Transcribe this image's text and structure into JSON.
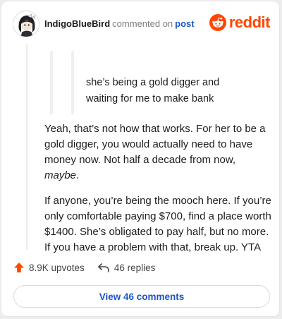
{
  "header": {
    "username": "IndigoBlueBird",
    "action": "commented on",
    "post_link": "post",
    "brand_name": "reddit",
    "brand_color": "#ff4500",
    "avatar_icon": "user-avatar-illustration",
    "brand_icon": "reddit-snoo-icon"
  },
  "quote": {
    "line1": "she’s being a gold digger and",
    "line2": "waiting for me to make bank"
  },
  "comment": {
    "p1_main": "Yeah, that’s not how that works. For her to be a gold digger, you would actually need to have money now. Not half a decade from now, ",
    "p1_em": "maybe",
    "p1_end": ".",
    "p2": "If anyone, you’re being the mooch here. If you’re only comfortable paying $700, find a place worth $1400. She’s obligated to pay half, but no more. If you have a problem with that, break up. YTA"
  },
  "footer": {
    "upvotes": "8.9K upvotes",
    "replies": "46 replies",
    "view_comments": "View 46 comments",
    "upvote_icon": "upvote-arrow-icon",
    "reply_icon": "reply-arrow-icon",
    "link_color": "#1b55c9"
  }
}
